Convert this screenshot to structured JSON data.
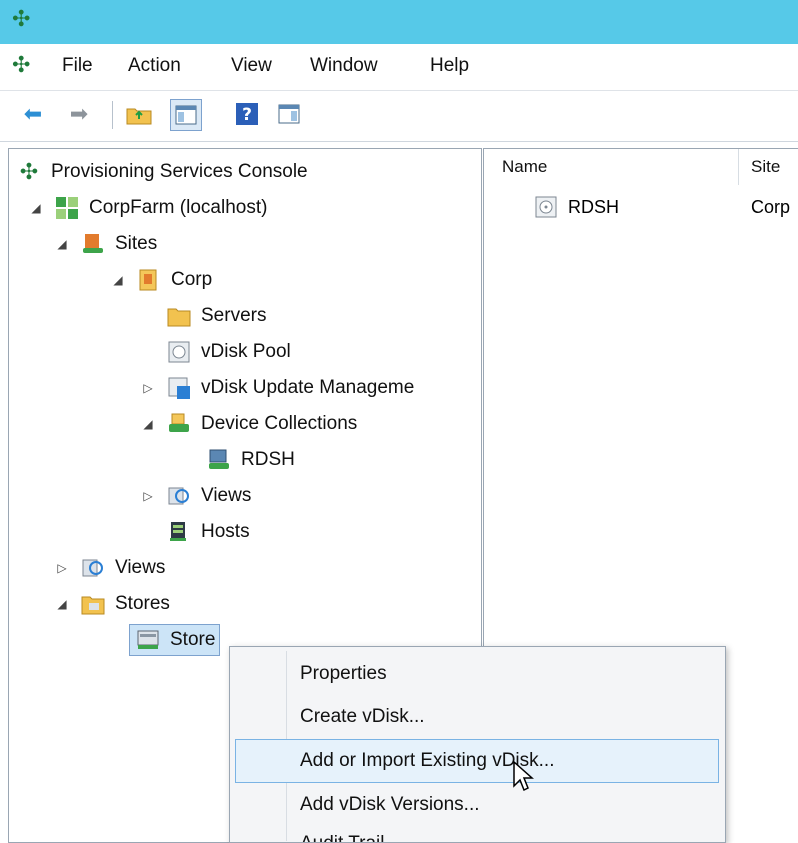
{
  "menu": {
    "items": [
      "File",
      "Action",
      "View",
      "Window",
      "Help"
    ]
  },
  "toolbar": {
    "back_icon": "back-arrow-icon",
    "forward_icon": "forward-arrow-icon",
    "up_icon": "up-folder-icon",
    "show_hide_tree_icon": "console-tree-icon",
    "help_icon": "help-icon",
    "action_pane_icon": "action-pane-icon"
  },
  "tree": {
    "root": "Provisioning Services Console",
    "farm": "CorpFarm (localhost)",
    "sites": "Sites",
    "site": "Corp",
    "servers": "Servers",
    "vdisk_pool": "vDisk Pool",
    "vdisk_update": "vDisk Update Manageme",
    "device_collections": "Device Collections",
    "rdsh": "RDSH",
    "site_views": "Views",
    "hosts": "Hosts",
    "views": "Views",
    "stores": "Stores",
    "store": "Store"
  },
  "list": {
    "columns": {
      "name": "Name",
      "site": "Site"
    },
    "rows": [
      {
        "name": "RDSH",
        "site": "Corp"
      }
    ]
  },
  "context_menu": {
    "items": [
      "Properties",
      "Create vDisk...",
      "Add or Import Existing vDisk...",
      "Add vDisk Versions...",
      "Audit Trail..."
    ],
    "highlighted_index": 2
  },
  "colors": {
    "titlebar": "#56c9e8",
    "selection": "#cce4f7",
    "highlight": "#e6f2fb",
    "highlight_border": "#7ab3e4"
  }
}
